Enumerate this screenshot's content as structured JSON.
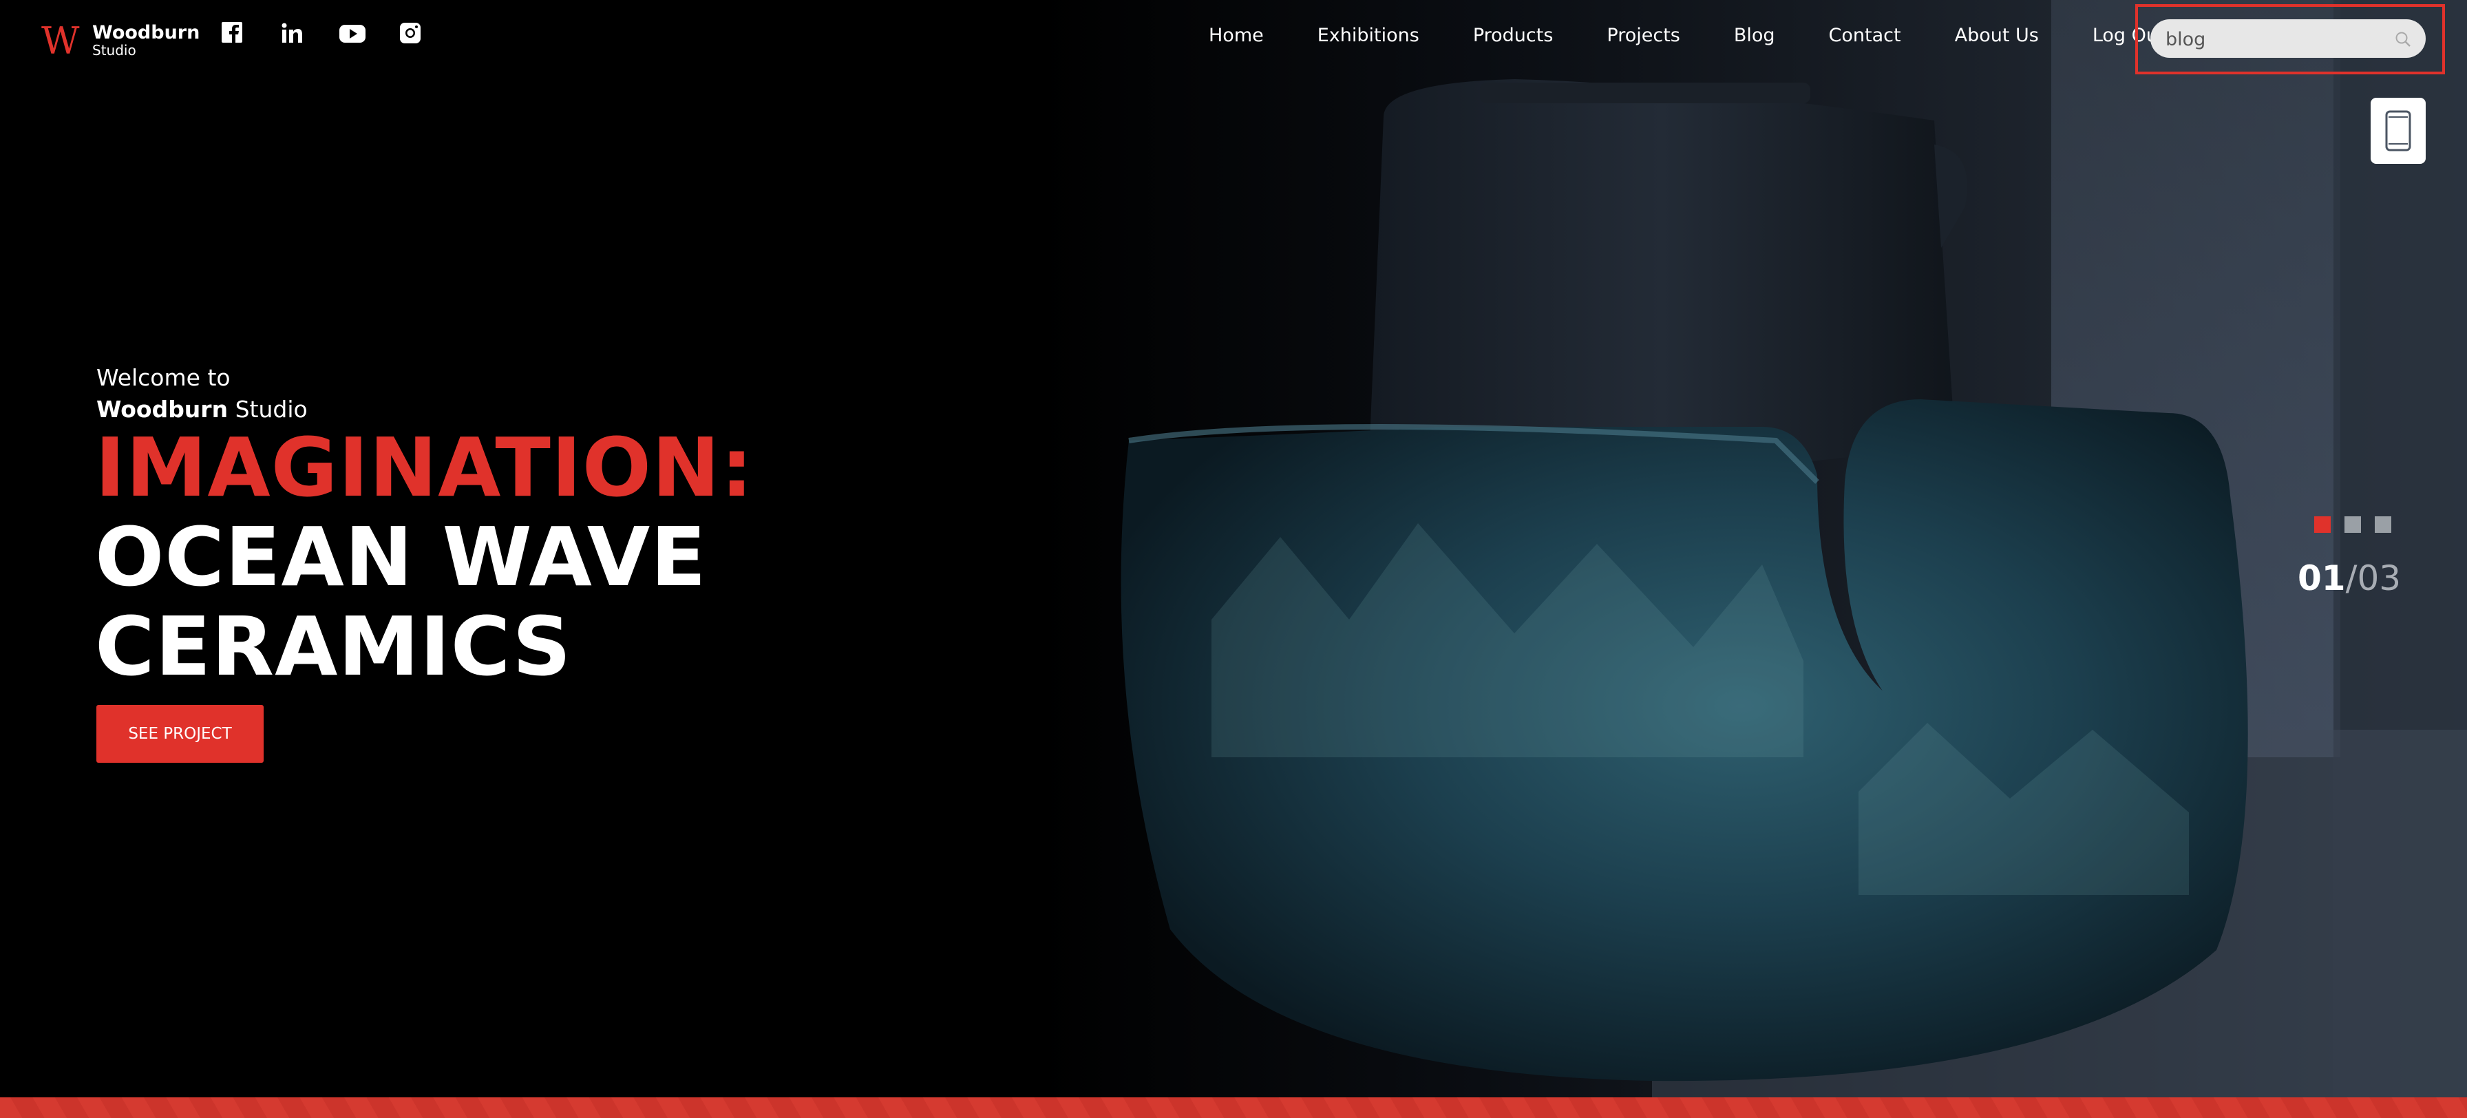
{
  "brand": {
    "name": "Woodburn",
    "sub": "Studio",
    "logo_letter": "W"
  },
  "social": [
    "facebook-icon",
    "linkedin-icon",
    "youtube-icon",
    "instagram-icon"
  ],
  "nav": [
    "Home",
    "Exhibitions",
    "Products",
    "Projects",
    "Blog",
    "Contact",
    "About Us",
    "Log Out"
  ],
  "search": {
    "value": "blog"
  },
  "hero": {
    "welcome": "Welcome to",
    "studio_bold": "Woodburn",
    "studio_rest": "Studio",
    "line1": "IMAGINATION:",
    "line2": "OCEAN WAVE",
    "line3": "CERAMICS",
    "cta": "SEE PROJECT"
  },
  "slider": {
    "current": "01",
    "separator": "/",
    "total": "03",
    "active_index": 0
  },
  "colors": {
    "accent": "#e0322b",
    "background": "#000000",
    "dot_inactive": "#9aa0a6"
  }
}
